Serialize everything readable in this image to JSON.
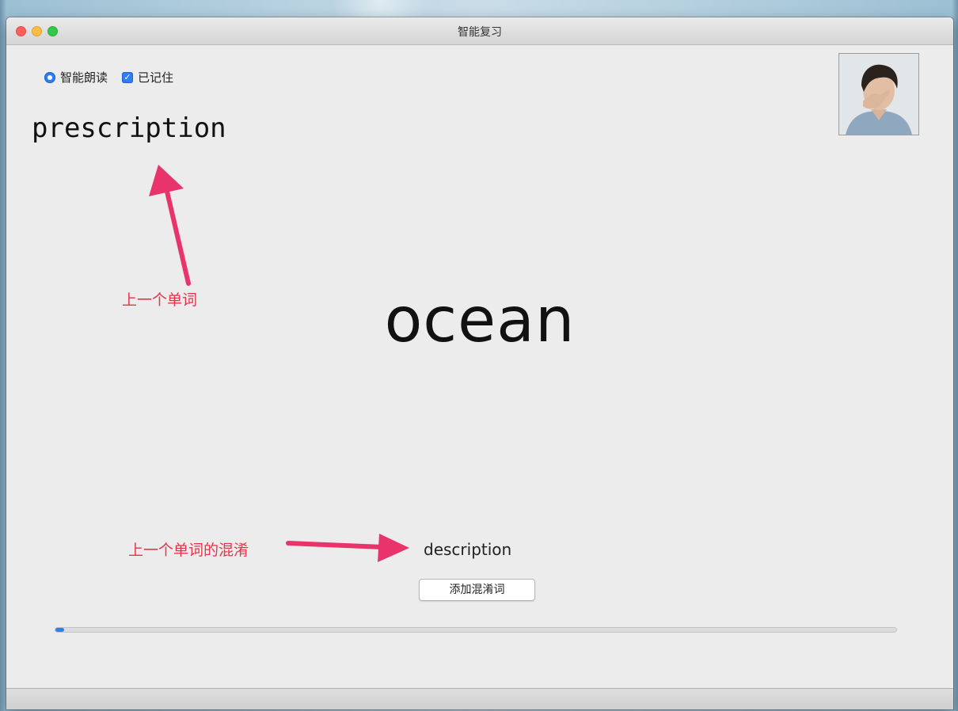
{
  "window": {
    "title": "智能复习"
  },
  "options": {
    "smart_read_label": "智能朗读",
    "smart_read_selected": true,
    "remembered_label": "已记住",
    "remembered_checked": true
  },
  "previous_word": "prescription",
  "current_word": "ocean",
  "confusable_word": "description",
  "add_confusable_button": "添加混淆词",
  "progress": 0.01,
  "annotations": {
    "previous_word_note": "上一个单词",
    "confusable_note": "上一个单词的混淆"
  },
  "colors": {
    "accent": "#2f7cf6",
    "annotation": "#e8334a"
  },
  "icons": {
    "radio": "radio-selected-icon",
    "checkbox": "checkbox-checked-icon",
    "avatar": "user-avatar-photo"
  }
}
